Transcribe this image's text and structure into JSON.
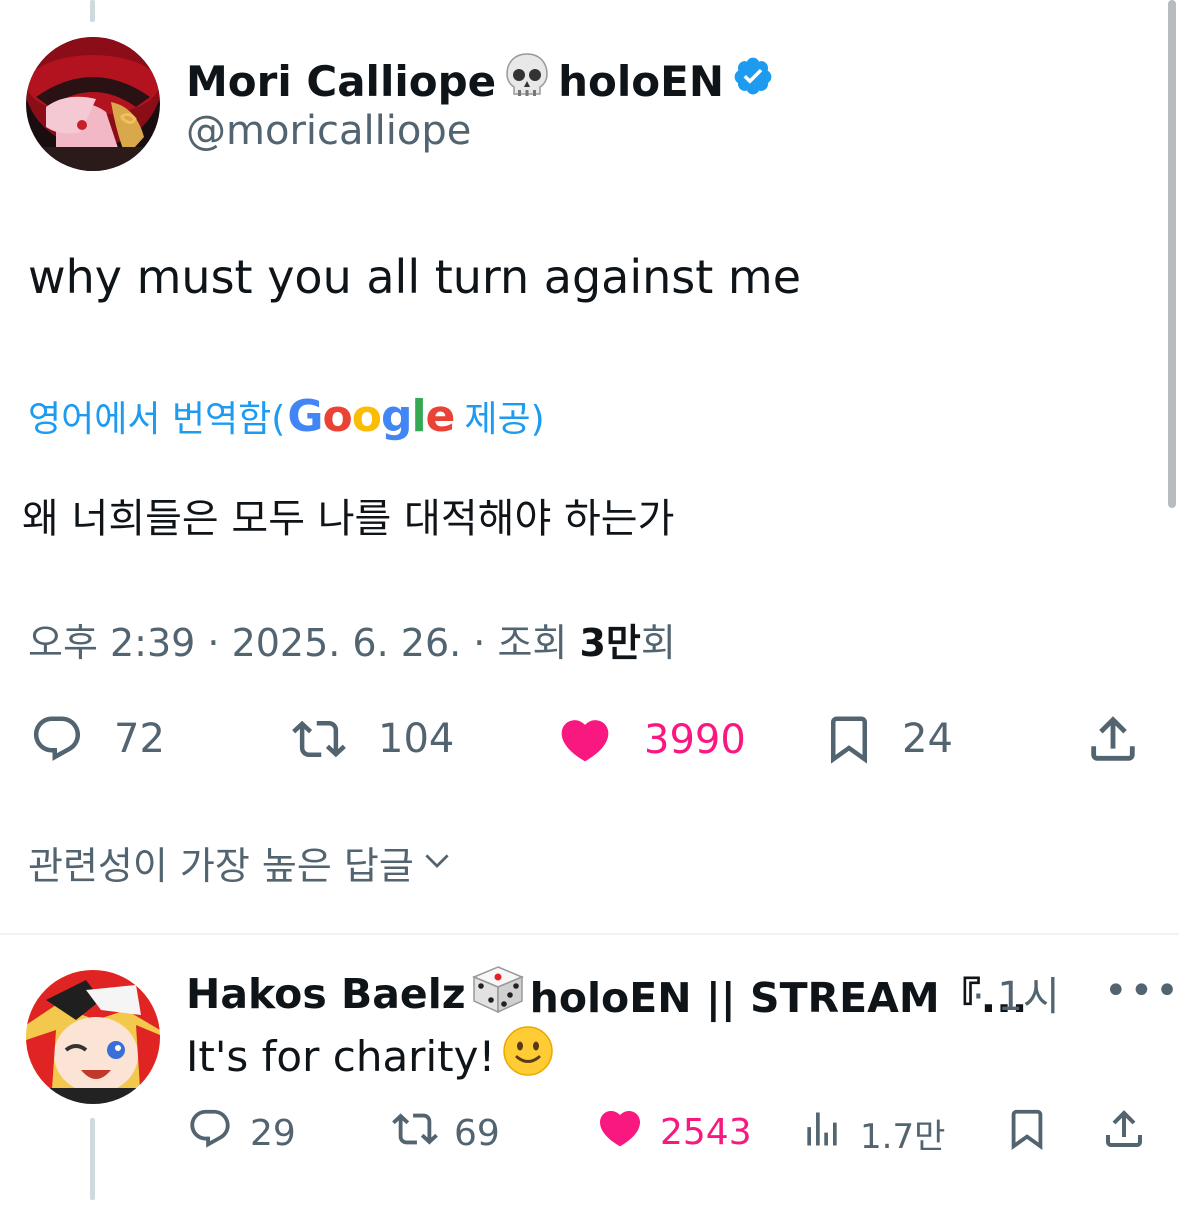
{
  "tweet": {
    "display_name": "Mori Calliope",
    "name_suffix": "holoEN",
    "handle": "@moricalliope",
    "text": "why must you all turn against me",
    "translation": {
      "prefix": "영어에서 번역함(",
      "provider": "Google",
      "suffix": " 제공)",
      "text": "왜 너희들은 모두 나를 대적해야 하는가"
    },
    "meta": {
      "time": "오후 2:39 · 2025. 6. 26. · 조회 ",
      "views": "3만",
      "views_suffix": "회"
    },
    "actions": {
      "replies": "72",
      "retweets": "104",
      "likes": "3990",
      "bookmarks": "24"
    }
  },
  "replies_sort_label": "관련성이 가장 높은 답글",
  "reply": {
    "display_name": "Hakos Baelz",
    "name_suffix": "holoEN || STREAM『...",
    "time": "· 1시",
    "more": "•••",
    "text": "It's for charity!",
    "actions": {
      "replies": "29",
      "retweets": "69",
      "likes": "2543",
      "views": "1.7만"
    }
  },
  "colors": {
    "like": "#f91880",
    "link": "#1d9bf0",
    "muted": "#536471",
    "verified": "#1d9bf0"
  },
  "icons": [
    "skull-emoji",
    "verified-badge-icon",
    "reply-icon",
    "retweet-icon",
    "heart-icon",
    "bookmark-icon",
    "share-icon",
    "chevron-down-icon",
    "dice-emoji",
    "smile-emoji",
    "views-icon",
    "more-icon"
  ]
}
